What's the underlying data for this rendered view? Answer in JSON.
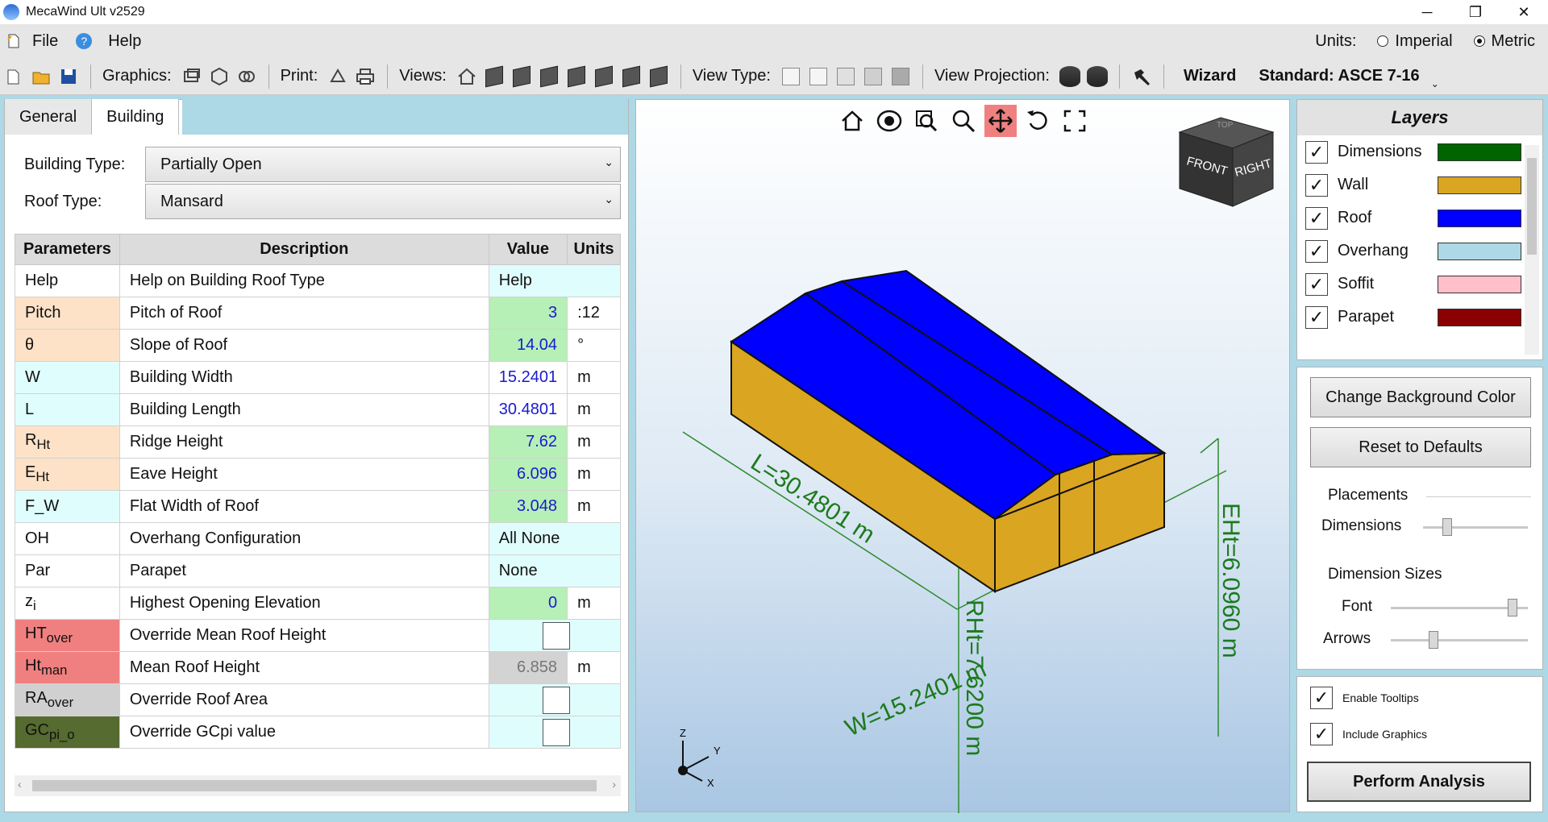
{
  "window": {
    "title": "MecaWind Ult v2529",
    "controls": {
      "minimize": "─",
      "restore": "❐",
      "close": "✕"
    }
  },
  "menu": {
    "file": "File",
    "help": "Help",
    "help_glyph": "?",
    "units_label": "Units:",
    "imperial": "Imperial",
    "metric": "Metric",
    "selected_unit": "Metric"
  },
  "toolbar": {
    "graphics": "Graphics:",
    "print": "Print:",
    "views": "Views:",
    "view_type": "View Type:",
    "view_projection": "View Projection:",
    "wizard": "Wizard",
    "standard": "Standard: ASCE 7-16"
  },
  "tabs": {
    "general": "General",
    "building": "Building",
    "active": "Building"
  },
  "building_type": {
    "label": "Building Type:",
    "value": "Partially Open"
  },
  "roof_type": {
    "label": "Roof Type:",
    "value": "Mansard"
  },
  "table": {
    "headers": {
      "param": "Parameters",
      "desc": "Description",
      "value": "Value",
      "units": "Units"
    },
    "rows": [
      {
        "param": "Help",
        "desc": "Help on Building Roof Type",
        "value": "Help",
        "units": ""
      },
      {
        "param": "Pitch",
        "desc": "Pitch of Roof",
        "value": "3",
        "units": ":12"
      },
      {
        "param": "θ",
        "desc": "Slope of Roof",
        "value": "14.04",
        "units": "°"
      },
      {
        "param": "W",
        "desc": "Building Width",
        "value": "15.2401",
        "units": "m"
      },
      {
        "param": "L",
        "desc": "Building Length",
        "value": "30.4801",
        "units": "m"
      },
      {
        "param_main": "R",
        "param_sub": "Ht",
        "desc": "Ridge Height",
        "value": "7.62",
        "units": "m"
      },
      {
        "param_main": "E",
        "param_sub": "Ht",
        "desc": "Eave Height",
        "value": "6.096",
        "units": "m"
      },
      {
        "param": "F_W",
        "desc": "Flat Width of Roof",
        "value": "3.048",
        "units": "m"
      },
      {
        "param": "OH",
        "desc": "Overhang Configuration",
        "value": "All None",
        "units": ""
      },
      {
        "param": "Par",
        "desc": "Parapet",
        "value": "None",
        "units": ""
      },
      {
        "param_main": "z",
        "param_sub": "i",
        "desc": "Highest Opening Elevation",
        "value": "0",
        "units": "m"
      },
      {
        "param_main": "HT",
        "param_sub": "over",
        "desc": "Override Mean Roof Height",
        "value": "",
        "units": ""
      },
      {
        "param_main": "Ht",
        "param_sub": "man",
        "desc": "Mean Roof Height",
        "value": "6.858",
        "units": "m"
      },
      {
        "param_main": "RA",
        "param_sub": "over",
        "desc": "Override Roof Area",
        "value": "",
        "units": ""
      },
      {
        "param_main": "GC",
        "param_sub": "pi_o",
        "desc": "Override GCpi value",
        "value": "",
        "units": ""
      }
    ]
  },
  "viewport": {
    "labels": {
      "length": "L=30.4801 m",
      "width": "W=15.2401 m",
      "ridge": "RHt=7.6200 m",
      "eave": "EHt=6.0960 m"
    },
    "cube": {
      "front": "FRONT",
      "right": "RIGHT",
      "top": "TOP"
    },
    "axes": {
      "z": "Z",
      "y": "Y",
      "x": "X"
    },
    "colors": {
      "roof": "#0000ff",
      "wall": "#daa520",
      "dimension": "#008000"
    }
  },
  "layers": {
    "title": "Layers",
    "items": [
      {
        "name": "Dimensions",
        "color": "#006400",
        "check": "✓"
      },
      {
        "name": "Wall",
        "color": "#daa520",
        "check": "✓"
      },
      {
        "name": "Roof",
        "color": "#0000ff",
        "check": "✓"
      },
      {
        "name": "Overhang",
        "color": "#add8e6",
        "check": "✓"
      },
      {
        "name": "Soffit",
        "color": "#ffc0cb",
        "check": "✓"
      },
      {
        "name": "Parapet",
        "color": "#8b0000",
        "check": "✓"
      }
    ]
  },
  "options": {
    "change_bg": "Change Background Color",
    "reset": "Reset to Defaults",
    "placements": "Placements",
    "dimensions": "Dimensions",
    "dimension_sizes": "Dimension Sizes",
    "font": "Font",
    "arrows": "Arrows",
    "placement_dimensions_level": 0.2,
    "font_level": 0.92,
    "arrows_level": 0.3
  },
  "bottom": {
    "tooltips": "Enable Tooltips",
    "graphics": "Include Graphics",
    "perform": "Perform Analysis",
    "check": "✓"
  }
}
